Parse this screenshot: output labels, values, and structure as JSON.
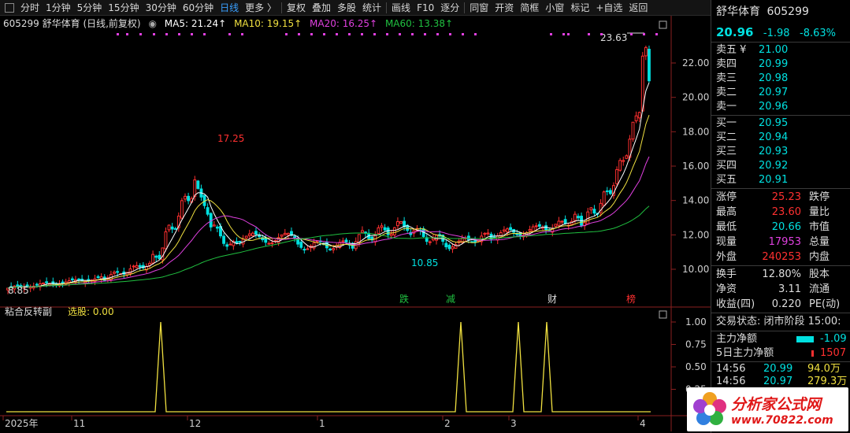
{
  "toolbar": {
    "items": [
      "分时",
      "1分钟",
      "5分钟",
      "15分钟",
      "30分钟",
      "60分钟",
      "日线",
      "更多 〉",
      "复权",
      "叠加",
      "多股",
      "统计",
      "画线",
      "F10",
      "逐分",
      "同窗",
      "开资",
      "简框",
      "小窗",
      "标记",
      "+自选",
      "返回"
    ],
    "active_item": "日线"
  },
  "kline": {
    "code_title": "605299 舒华体育 (日线,前复权)",
    "ma5": "MA5: 21.24↑",
    "ma10": "MA10: 19.15↑",
    "ma20": "MA20: 16.25↑",
    "ma60": "MA60: 13.38↑",
    "price_ticks": [
      "22.00",
      "20.00",
      "18.00",
      "16.00",
      "14.00",
      "12.00",
      "10.00"
    ],
    "marks": {
      "high": "23.63",
      "peak": "17.25",
      "low": "10.85",
      "start_low": "8.85"
    },
    "events": [
      "跌",
      "减",
      "财",
      "榜"
    ],
    "colors": {
      "ma5": "#ffffff",
      "ma10": "#f0e040",
      "ma20": "#e040e0",
      "ma60": "#20c040",
      "up": "#ff3030",
      "down": "#00e0e0"
    }
  },
  "indicator": {
    "name": "粘合反转副",
    "select_label": "选股: 0.00",
    "ticks": [
      "1.00",
      "0.75",
      "0.50",
      "0.25"
    ],
    "signal_color": "#f0e040"
  },
  "time_axis": [
    "2025年",
    "11",
    "12",
    "1",
    "2",
    "3",
    "4"
  ],
  "quote": {
    "name": "舒华体育",
    "code": "605299",
    "price": "20.96",
    "change": "-1.98",
    "change_pct": "-8.63%",
    "asks": [
      {
        "label": "卖五 ¥",
        "price": "21.00"
      },
      {
        "label": "卖四",
        "price": "20.99"
      },
      {
        "label": "卖三",
        "price": "20.98"
      },
      {
        "label": "卖二",
        "price": "20.97"
      },
      {
        "label": "卖一",
        "price": "20.96"
      }
    ],
    "bids": [
      {
        "label": "买一",
        "price": "20.95"
      },
      {
        "label": "买二",
        "price": "20.94"
      },
      {
        "label": "买三",
        "price": "20.93"
      },
      {
        "label": "买四",
        "price": "20.92"
      },
      {
        "label": "买五",
        "price": "20.91"
      }
    ],
    "stats": [
      {
        "l1": "涨停",
        "v1": "25.23",
        "c1": "#ff3030",
        "l2": "跌停"
      },
      {
        "l1": "最高",
        "v1": "23.60",
        "c1": "#ff3030",
        "l2": "量比"
      },
      {
        "l1": "最低",
        "v1": "20.66",
        "c1": "#00e0e0",
        "l2": "市值"
      },
      {
        "l1": "现量",
        "v1": "17953",
        "c1": "#e040e0",
        "l2": "总量"
      },
      {
        "l1": "外盘",
        "v1": "240253",
        "c1": "#ff3030",
        "l2": "内盘"
      }
    ],
    "stats2": [
      {
        "l1": "换手",
        "v1": "12.80%",
        "c1": "#dddddd",
        "l2": "股本"
      },
      {
        "l1": "净资",
        "v1": "3.11",
        "c1": "#dddddd",
        "l2": "流通"
      },
      {
        "l1": "收益(四)",
        "v1": "0.220",
        "c1": "#dddddd",
        "l2": "PE(动)"
      }
    ],
    "status": "交易状态: 闭市阶段 15:00:",
    "flows": [
      {
        "label": "主力净额",
        "value": "-1.09",
        "color": "#00e0e0"
      },
      {
        "label": "5日主力净额",
        "value": "1507",
        "color": "#ff3030"
      }
    ],
    "ticks": [
      {
        "time": "14:56",
        "price": "20.99",
        "vol": "94.0万"
      },
      {
        "time": "14:56",
        "price": "20.97",
        "vol": "279.3万"
      }
    ]
  },
  "logo": {
    "line1": "分析家公式网",
    "line2": "www.70822.com"
  }
}
